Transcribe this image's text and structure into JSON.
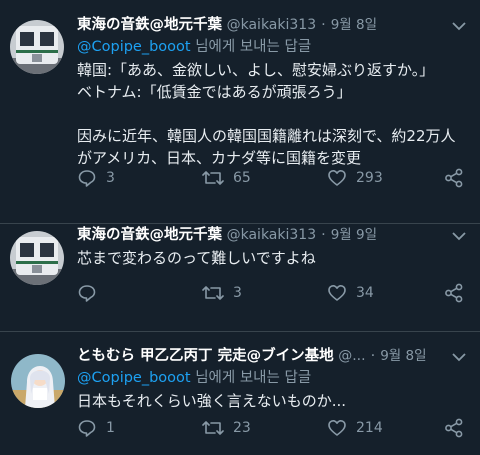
{
  "colors": {
    "background": "#15202b",
    "divider": "#38444d",
    "secondary_text": "#8899a6",
    "link": "#1da1f2"
  },
  "tweets": [
    {
      "display_name": "東海の音鉄@地元千葉",
      "handle": "@kaikaki313",
      "separator": "·",
      "time": "9월 8일",
      "reply_mention": "@Copipe_booot",
      "reply_suffix": " 님에게 보내는 답글",
      "text": "韓国:「ああ、金欲しい、よし、慰安婦ぶり返すか。」\nベトナム:「低賃金ではあるが頑張ろう」\n\n因みに近年、韓国人の韓国国籍離れは深刻で、約22万人がアメリカ、日本、カナダ等に国籍を変更",
      "replies": "3",
      "retweets": "65",
      "likes": "293",
      "avatar_icon": "train-avatar"
    },
    {
      "display_name": "東海の音鉄@地元千葉",
      "handle": "@kaikaki313",
      "separator": "·",
      "time": "9월 9일",
      "text": "芯まで変わるのって難しいですよね",
      "replies": "",
      "retweets": "3",
      "likes": "34",
      "avatar_icon": "train-avatar"
    },
    {
      "display_name": "ともむら 甲乙乙丙丁 完走@ブイン基地",
      "handle": "@...",
      "separator": "·",
      "time": "9월 8일",
      "reply_mention": "@Copipe_booot",
      "reply_suffix": " 님에게 보내는 답글",
      "text": "日本もそれくらい強く言えないものか...",
      "replies": "1",
      "retweets": "23",
      "likes": "214",
      "avatar_icon": "anime-girl-avatar"
    }
  ]
}
